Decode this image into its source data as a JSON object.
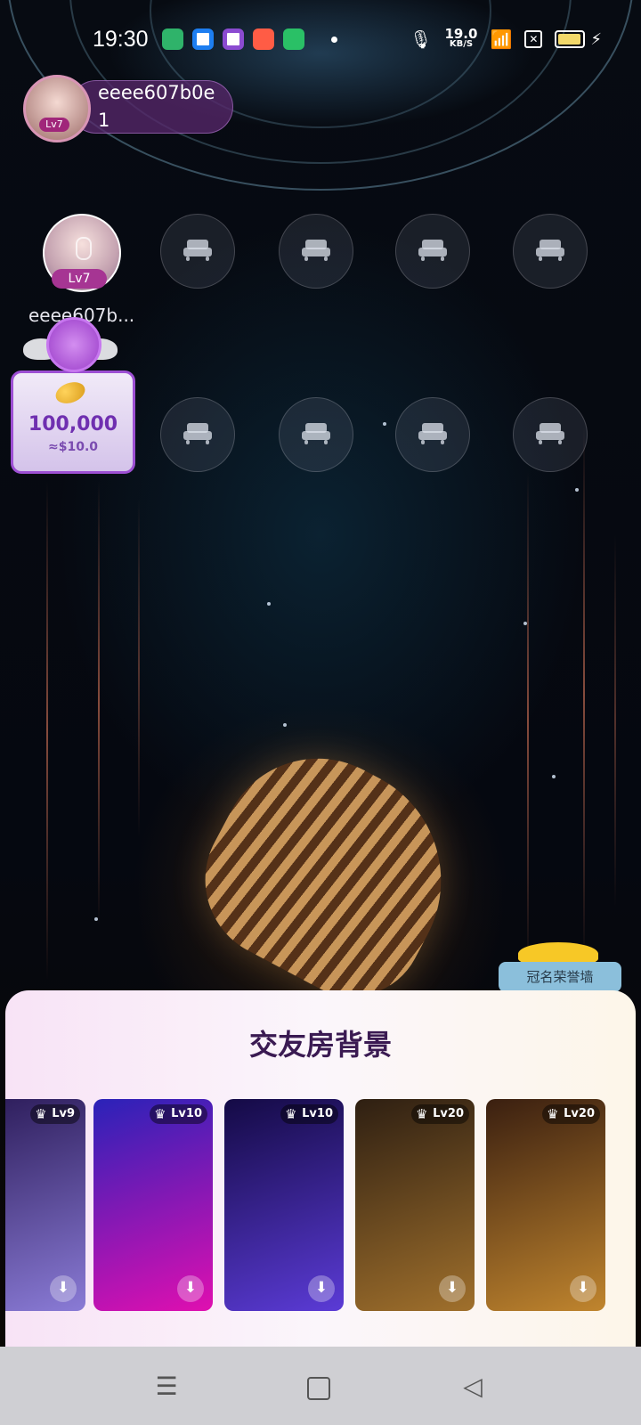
{
  "status_bar": {
    "time": "19:30",
    "network_speed_value": "19.0",
    "network_speed_unit": "KB/S",
    "icons": [
      "microphone-icon",
      "wifi-icon",
      "no-sim-icon",
      "battery-icon",
      "charging-icon"
    ]
  },
  "host": {
    "name": "eeee607b0e",
    "sub": "1",
    "level": "Lv7"
  },
  "seats": {
    "occupant": {
      "name": "eeee607b...",
      "level": "Lv7"
    }
  },
  "gift_card": {
    "amount": "100,000",
    "usd": "≈$10.0"
  },
  "honor_wall": {
    "label": "冠名荣誉墙"
  },
  "background_sheet": {
    "title": "交友房背景",
    "items": [
      {
        "level": "Lv9",
        "colors": [
          "#2a1a57",
          "#8a7bd6"
        ]
      },
      {
        "level": "Lv10",
        "colors": [
          "#2a22b8",
          "#e00fb0"
        ]
      },
      {
        "level": "Lv10",
        "colors": [
          "#140a45",
          "#5b3bd6"
        ]
      },
      {
        "level": "Lv20",
        "colors": [
          "#2e1f12",
          "#a0702c"
        ]
      },
      {
        "level": "Lv20",
        "colors": [
          "#3a1f10",
          "#c0852e"
        ]
      }
    ]
  },
  "nav_bar": {
    "menu_icon": "menu-icon",
    "home_icon": "home-icon",
    "back_icon": "back-icon"
  }
}
